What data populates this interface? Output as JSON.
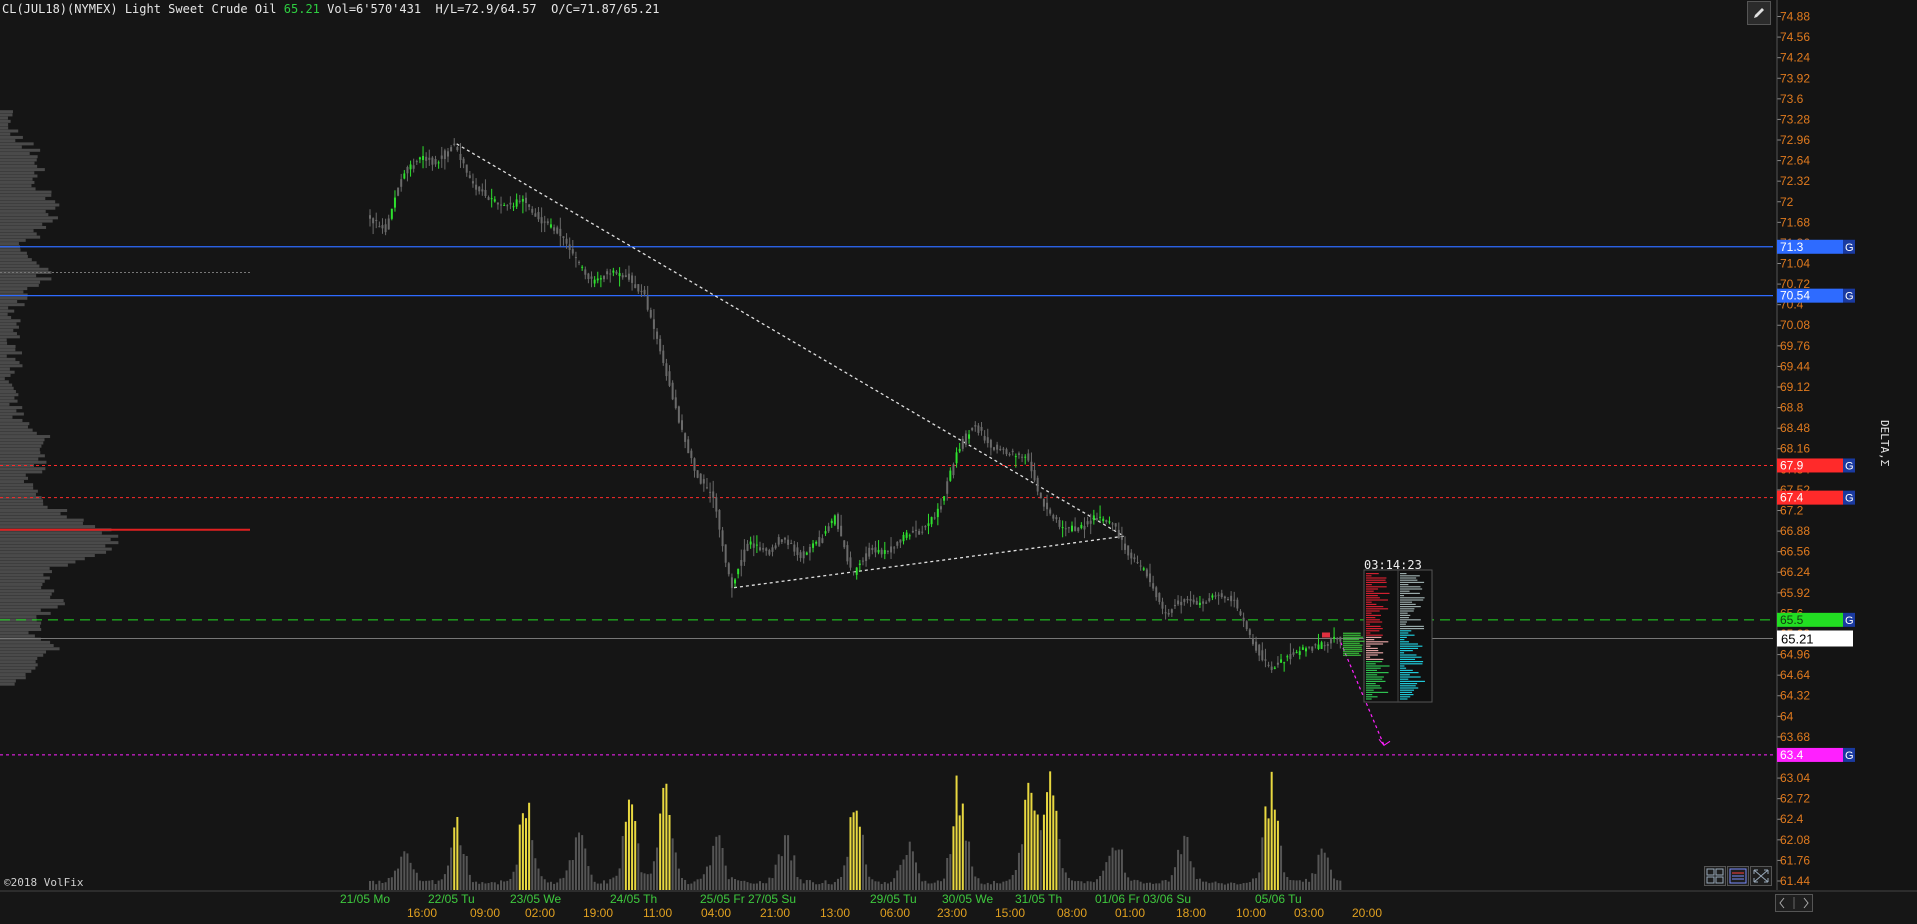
{
  "header": {
    "symbol": "CL(JUL18)(NYMEX) Light Sweet Crude Oil",
    "last_price": "65.21",
    "stats": "Vol=6'570'431  H/L=72.9/64.57  O/C=71.87/65.21"
  },
  "copyright": "©2018 VolFix",
  "delta_label": "DELTA,Σ",
  "timer": "03:14:23",
  "icons": {
    "draw": "pencil-icon",
    "layout": "grid-layout-icon",
    "fullscreen": "expand-icon",
    "scroll": "scroll-arrows-icon"
  },
  "colors": {
    "background": "#151515",
    "axis_text": "#e07a1e",
    "time_top": "#3ec93e",
    "time_bottom": "#e0a020",
    "candle_up": "#2ee02e",
    "candle_down": "#6a6a6a",
    "volume": "#555555",
    "volume_peak": "#e8d840",
    "level_blue": "#2e6bff",
    "level_red": "#ff2a2a",
    "level_green": "#22dd22",
    "level_magenta": "#ff20ff",
    "trendline": "#e0e0e0"
  },
  "chart_data": {
    "type": "candlestick",
    "title": "CL(JUL18)(NYMEX) Light Sweet Crude Oil",
    "price_axis": {
      "ylim": [
        61.3,
        74.95
      ],
      "ticks": [
        "74.88",
        "74.56",
        "74.24",
        "73.92",
        "73.6",
        "73.28",
        "72.96",
        "72.64",
        "72.32",
        "72",
        "71.68",
        "71.36",
        "71.04",
        "70.72",
        "70.4",
        "70.08",
        "69.76",
        "69.44",
        "69.12",
        "68.8",
        "68.48",
        "68.16",
        "67.84",
        "67.52",
        "67.2",
        "66.88",
        "66.56",
        "66.24",
        "65.92",
        "65.6",
        "65.28",
        "64.96",
        "64.64",
        "64.32",
        "64",
        "63.68",
        "63.36",
        "63.04",
        "62.72",
        "62.4",
        "62.08",
        "61.76",
        "61.44"
      ]
    },
    "time_axis": {
      "dates": [
        "21/05 Mo",
        "22/05 Tu",
        "23/05 We",
        "24/05 Th",
        "25/05 Fr 27/05 Su",
        "29/05 Tu",
        "30/05 We",
        "31/05 Th",
        "01/06 Fr 03/06 Su",
        "05/06 Tu"
      ],
      "hours": [
        "16:00",
        "09:00",
        "02:00",
        "19:00",
        "11:00",
        "04:00",
        "21:00",
        "13:00",
        "06:00",
        "23:00",
        "15:00",
        "08:00",
        "01:00",
        "18:00",
        "10:00",
        "03:00",
        "20:00"
      ]
    },
    "price_path": [
      {
        "t": 0,
        "p": 71.8
      },
      {
        "t": 1,
        "p": 71.55
      },
      {
        "t": 2,
        "p": 72.4
      },
      {
        "t": 3,
        "p": 72.7
      },
      {
        "t": 4,
        "p": 72.6
      },
      {
        "t": 5,
        "p": 72.9
      },
      {
        "t": 6,
        "p": 72.3
      },
      {
        "t": 7,
        "p": 72.05
      },
      {
        "t": 8,
        "p": 71.9
      },
      {
        "t": 9,
        "p": 72.05
      },
      {
        "t": 10,
        "p": 71.7
      },
      {
        "t": 11,
        "p": 71.55
      },
      {
        "t": 12,
        "p": 71.1
      },
      {
        "t": 13,
        "p": 70.75
      },
      {
        "t": 14,
        "p": 70.9
      },
      {
        "t": 15,
        "p": 70.85
      },
      {
        "t": 16,
        "p": 70.55
      },
      {
        "t": 17,
        "p": 69.6
      },
      {
        "t": 18,
        "p": 68.6
      },
      {
        "t": 19,
        "p": 67.75
      },
      {
        "t": 20,
        "p": 67.4
      },
      {
        "t": 21,
        "p": 66.0
      },
      {
        "t": 22,
        "p": 66.7
      },
      {
        "t": 23,
        "p": 66.55
      },
      {
        "t": 24,
        "p": 66.8
      },
      {
        "t": 25,
        "p": 66.5
      },
      {
        "t": 26,
        "p": 66.7
      },
      {
        "t": 27,
        "p": 67.1
      },
      {
        "t": 28,
        "p": 66.2
      },
      {
        "t": 29,
        "p": 66.6
      },
      {
        "t": 30,
        "p": 66.55
      },
      {
        "t": 31,
        "p": 66.8
      },
      {
        "t": 32,
        "p": 66.9
      },
      {
        "t": 33,
        "p": 67.2
      },
      {
        "t": 34,
        "p": 68.1
      },
      {
        "t": 35,
        "p": 68.55
      },
      {
        "t": 36,
        "p": 68.2
      },
      {
        "t": 37,
        "p": 68.1
      },
      {
        "t": 38,
        "p": 68.05
      },
      {
        "t": 39,
        "p": 67.3
      },
      {
        "t": 40,
        "p": 66.95
      },
      {
        "t": 41,
        "p": 66.9
      },
      {
        "t": 42,
        "p": 67.1
      },
      {
        "t": 43,
        "p": 67.0
      },
      {
        "t": 44,
        "p": 66.5
      },
      {
        "t": 45,
        "p": 66.2
      },
      {
        "t": 46,
        "p": 65.6
      },
      {
        "t": 47,
        "p": 65.8
      },
      {
        "t": 48,
        "p": 65.75
      },
      {
        "t": 49,
        "p": 65.9
      },
      {
        "t": 50,
        "p": 65.8
      },
      {
        "t": 51,
        "p": 65.2
      },
      {
        "t": 52,
        "p": 64.75
      },
      {
        "t": 53,
        "p": 64.9
      },
      {
        "t": 54,
        "p": 65.05
      },
      {
        "t": 55,
        "p": 65.1
      },
      {
        "t": 56,
        "p": 65.21
      }
    ],
    "levels": [
      {
        "price": 71.3,
        "label": "71.3",
        "style": "solid",
        "color": "#2e6bff"
      },
      {
        "price": 70.54,
        "label": "70.54",
        "style": "solid",
        "color": "#2e6bff"
      },
      {
        "price": 67.9,
        "label": "67.9",
        "style": "dashed",
        "color": "#ff2a2a"
      },
      {
        "price": 67.4,
        "label": "67.4",
        "style": "dashed",
        "color": "#ff2a2a"
      },
      {
        "price": 65.5,
        "label": "65.5",
        "style": "dashed",
        "color": "#22dd22"
      },
      {
        "price": 63.4,
        "label": "63.4",
        "style": "dashed",
        "color": "#ff20ff"
      }
    ],
    "level_tag": "G",
    "current_price": 65.21,
    "trendlines": [
      {
        "from": {
          "t": 5,
          "p": 72.9
        },
        "to": {
          "t": 43.5,
          "p": 66.8
        }
      },
      {
        "from": {
          "t": 21,
          "p": 66.0
        },
        "to": {
          "t": 43.5,
          "p": 66.8
        }
      }
    ],
    "projection": {
      "from": {
        "t": 56,
        "p": 65.15
      },
      "to": {
        "t": 58.5,
        "p": 63.55
      }
    },
    "volume_peaks": [
      {
        "t": 2,
        "v": 0.25
      },
      {
        "t": 5,
        "v": 0.45
      },
      {
        "t": 9,
        "v": 0.55
      },
      {
        "t": 12,
        "v": 0.35
      },
      {
        "t": 15,
        "v": 0.5
      },
      {
        "t": 17,
        "v": 0.7
      },
      {
        "t": 20,
        "v": 0.3
      },
      {
        "t": 24,
        "v": 0.35
      },
      {
        "t": 28,
        "v": 0.55
      },
      {
        "t": 31,
        "v": 0.3
      },
      {
        "t": 34,
        "v": 0.7
      },
      {
        "t": 38,
        "v": 0.6
      },
      {
        "t": 39.2,
        "v": 1.0
      },
      {
        "t": 43,
        "v": 0.35
      },
      {
        "t": 47,
        "v": 0.3
      },
      {
        "t": 52,
        "v": 0.68
      },
      {
        "t": 55,
        "v": 0.2
      }
    ]
  }
}
